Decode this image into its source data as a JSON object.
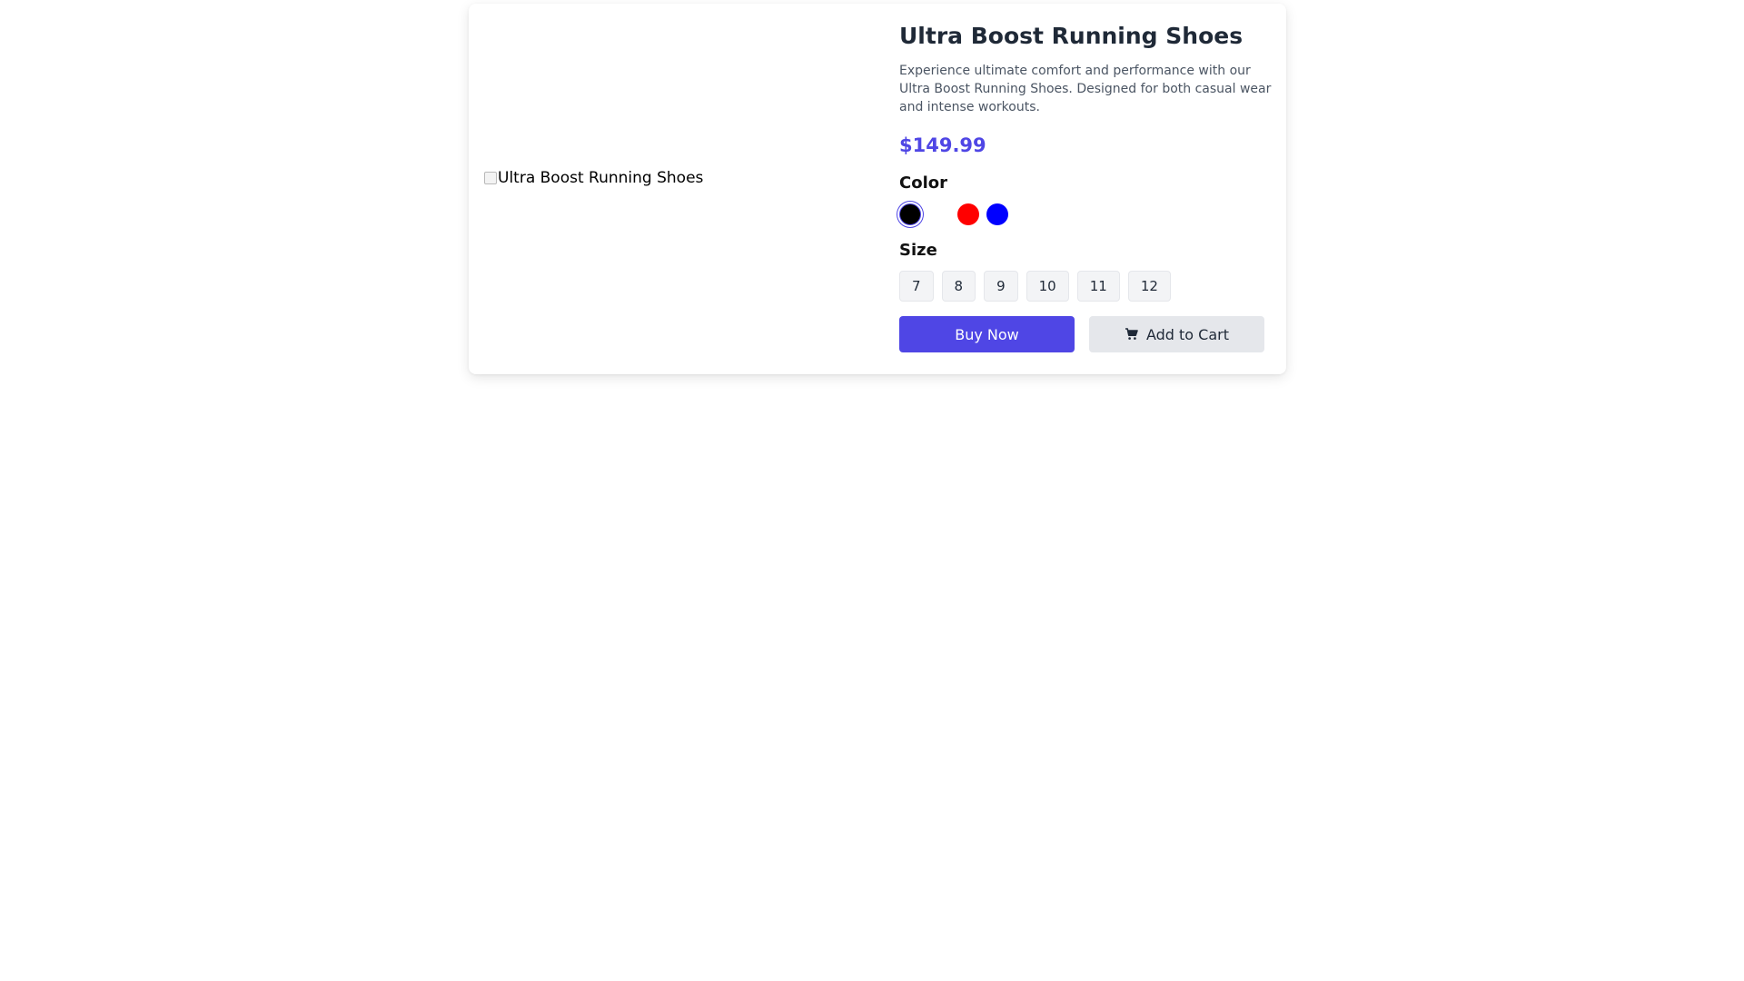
{
  "product": {
    "image_alt": "Ultra Boost Running Shoes",
    "title": "Ultra Boost Running Shoes",
    "description": "Experience ultimate comfort and performance with our Ultra Boost Running Shoes. Designed for both casual wear and intense workouts.",
    "price": "$149.99"
  },
  "colors": {
    "label": "Color",
    "options": [
      {
        "name": "black",
        "hex": "#000000",
        "selected": true
      },
      {
        "name": "white",
        "hex": "#ffffff",
        "selected": false
      },
      {
        "name": "red",
        "hex": "#ff0000",
        "selected": false
      },
      {
        "name": "blue",
        "hex": "#0000ff",
        "selected": false
      }
    ]
  },
  "sizes": {
    "label": "Size",
    "options": [
      "7",
      "8",
      "9",
      "10",
      "11",
      "12"
    ]
  },
  "actions": {
    "buy_now": "Buy Now",
    "add_to_cart": "Add to Cart"
  },
  "theme": {
    "accent": "#4f46e5"
  }
}
